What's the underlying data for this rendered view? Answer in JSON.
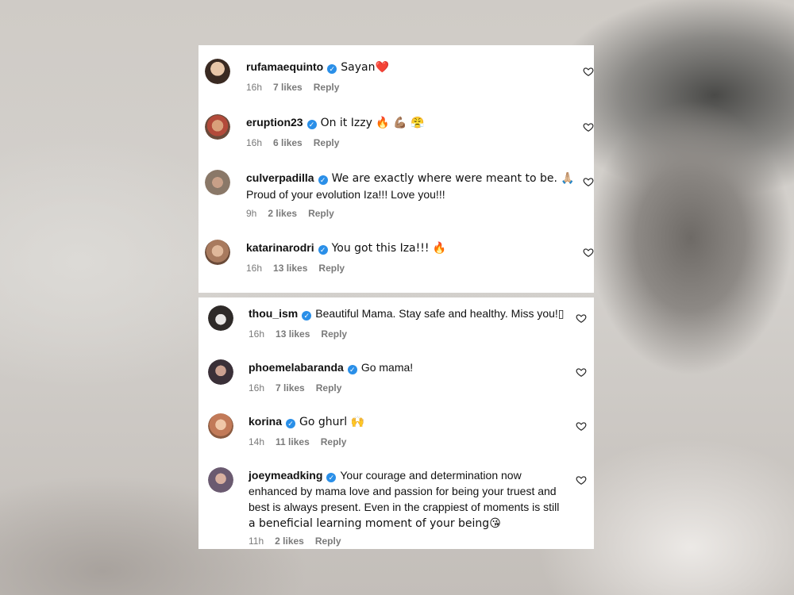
{
  "panels": [
    {
      "comments": [
        {
          "username": "rufamaequinto",
          "text": "Sayan❤️",
          "time": "16h",
          "likes": "7 likes",
          "reply": "Reply",
          "avatar_color": "#3a2a22"
        },
        {
          "username": "eruption23",
          "text": "On it Izzy 🔥 💪🏽 😤",
          "time": "16h",
          "likes": "6 likes",
          "reply": "Reply",
          "avatar_color": "#b36a4a"
        },
        {
          "username": "culverpadilla",
          "text": "We are exactly where were meant to be. 🙏🏼",
          "text2": "Proud of your evolution Iza!!! Love you!!!",
          "time": "9h",
          "likes": "2 likes",
          "reply": "Reply",
          "avatar_color": "#8a7868"
        },
        {
          "username": "katarinarodri",
          "text": "You got this Iza!!! 🔥",
          "time": "16h",
          "likes": "13 likes",
          "reply": "Reply",
          "avatar_color": "#a87a5e"
        }
      ]
    },
    {
      "comments": [
        {
          "username": "thou_ism",
          "text": "Beautiful Mama. Stay safe and healthy. Miss you!▯",
          "time": "16h",
          "likes": "13 likes",
          "reply": "Reply",
          "avatar_color": "#2e2a28"
        },
        {
          "username": "phoemelabaranda",
          "text": "Go mama!",
          "time": "16h",
          "likes": "7 likes",
          "reply": "Reply",
          "avatar_color": "#3a3038"
        },
        {
          "username": "korina",
          "text": "Go ghurl 🙌",
          "time": "14h",
          "likes": "11 likes",
          "reply": "Reply",
          "avatar_color": "#c27a58"
        },
        {
          "username": "joeymeadking",
          "text": "Your courage and determination now",
          "text2": "enhanced by mama love and passion for being your truest and",
          "text3": "best is always present. Even in the crappiest of moments is still",
          "text4": "a beneficial learning moment of your being😘",
          "time": "11h",
          "likes": "2 likes",
          "reply": "Reply",
          "avatar_color": "#6a5a70"
        }
      ]
    }
  ],
  "icons": {
    "verified": "verified-badge-icon",
    "like": "heart-outline-icon"
  },
  "colors": {
    "verified": "#2a8fe8",
    "meta": "#7a7a7a",
    "text": "#111111"
  }
}
